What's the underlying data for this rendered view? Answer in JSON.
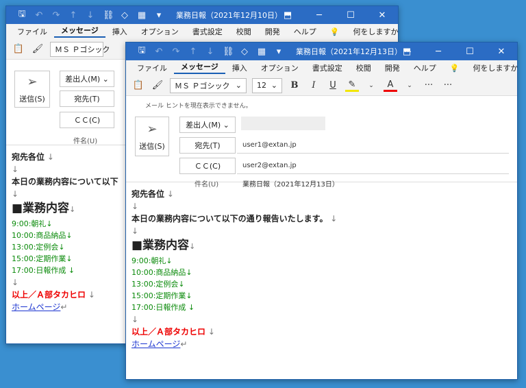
{
  "back": {
    "title": "業務日報（2021年12月10日） ···",
    "menu": [
      "ファイル",
      "メッセージ",
      "挿入",
      "オプション",
      "書式設定",
      "校閲",
      "開発",
      "ヘルプ",
      "何をしますか"
    ],
    "font_name": "ＭＳ Ｐゴシック",
    "send_label": "送信(S)",
    "from_label": "差出人(M)",
    "to_label": "宛先(T)",
    "cc_label": "ＣＣ(C)",
    "subject_label": "件名(U)",
    "body": {
      "greeting": "宛先各位",
      "intro": "本日の業務内容について以下",
      "heading": "■業務内容",
      "items": [
        "9:00:朝礼",
        "10:00:商品納品",
        "13:00:定例会",
        "15:00:定期作業",
        "17:00:日報作成"
      ],
      "signature": "以上／Ａ部タカヒロ",
      "link": "ホームページ"
    }
  },
  "front": {
    "title": "業務日報（2021年12月13日） ···",
    "menu": [
      "ファイル",
      "メッセージ",
      "挿入",
      "オプション",
      "書式設定",
      "校閲",
      "開発",
      "ヘルプ",
      "何をしますか"
    ],
    "font_name": "ＭＳ Ｐゴシック",
    "font_size": "12",
    "hint": "メール ヒントを現在表示できません。",
    "send_label": "送信(S)",
    "from_label": "差出人(M)",
    "to_label": "宛先(T)",
    "to_value": "user1@extan.jp",
    "cc_label": "ＣＣ(C)",
    "cc_value": "user2@extan.jp",
    "subject_label": "件名(U)",
    "subject_value": "業務日報（2021年12月13日）",
    "body": {
      "greeting": "宛先各位",
      "intro": "本日の業務内容について以下の通り報告いたします。",
      "heading": "■業務内容",
      "items": [
        "9:00:朝礼",
        "10:00:商品納品",
        "13:00:定例会",
        "15:00:定期作業",
        "17:00:日報作成"
      ],
      "signature": "以上／Ａ部タカヒロ",
      "link": "ホームページ"
    }
  },
  "colors": {
    "titlebar": "#2b6cc4",
    "link": "#1a33d0",
    "green": "#0a8a0a",
    "red": "#e00000",
    "desktop": "#3a8fd0"
  }
}
